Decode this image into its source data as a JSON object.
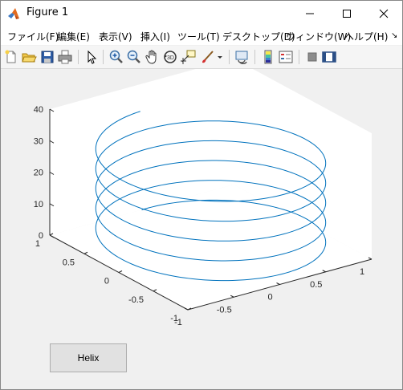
{
  "window": {
    "title": "Figure 1",
    "controls": [
      "minimize-icon",
      "maximize-icon",
      "close-icon"
    ]
  },
  "menu": {
    "items": [
      "ファイル(F)",
      "編集(E)",
      "表示(V)",
      "挿入(I)",
      "ツール(T)",
      "デスクトップ(D)",
      "ウィンドウ(W)",
      "ヘルプ(H)"
    ]
  },
  "toolbar": {
    "icons": [
      "new-figure-icon",
      "open-file-icon",
      "save-icon",
      "print-icon",
      "edit-plot-arrow-icon",
      "zoom-in-icon",
      "zoom-out-icon",
      "pan-hand-icon",
      "rotate-3d-icon",
      "data-cursor-icon",
      "brush-icon",
      "link-plot-icon",
      "colorbar-icon",
      "legend-icon",
      "hide-plot-tools-icon",
      "show-plot-tools-icon"
    ]
  },
  "button": {
    "label": "Helix"
  },
  "chart_data": {
    "type": "line",
    "projection": "3d",
    "title": "",
    "xlabel": "",
    "ylabel": "",
    "zlabel": "",
    "xlim": [
      -1,
      1
    ],
    "ylim": [
      -1,
      1
    ],
    "zlim": [
      0,
      40
    ],
    "xticks": [
      "-1",
      "-0.5",
      "0",
      "0.5",
      "1"
    ],
    "yticks": [
      "-1",
      "-0.5",
      "0",
      "0.5",
      "1"
    ],
    "zticks": [
      "0",
      "10",
      "20",
      "30",
      "40"
    ],
    "grid": false,
    "series": [
      {
        "color": "#0072bd",
        "equation": "x = sin(t), y = cos(t), z = t",
        "t_range": [
          0,
          31.4
        ]
      }
    ]
  }
}
